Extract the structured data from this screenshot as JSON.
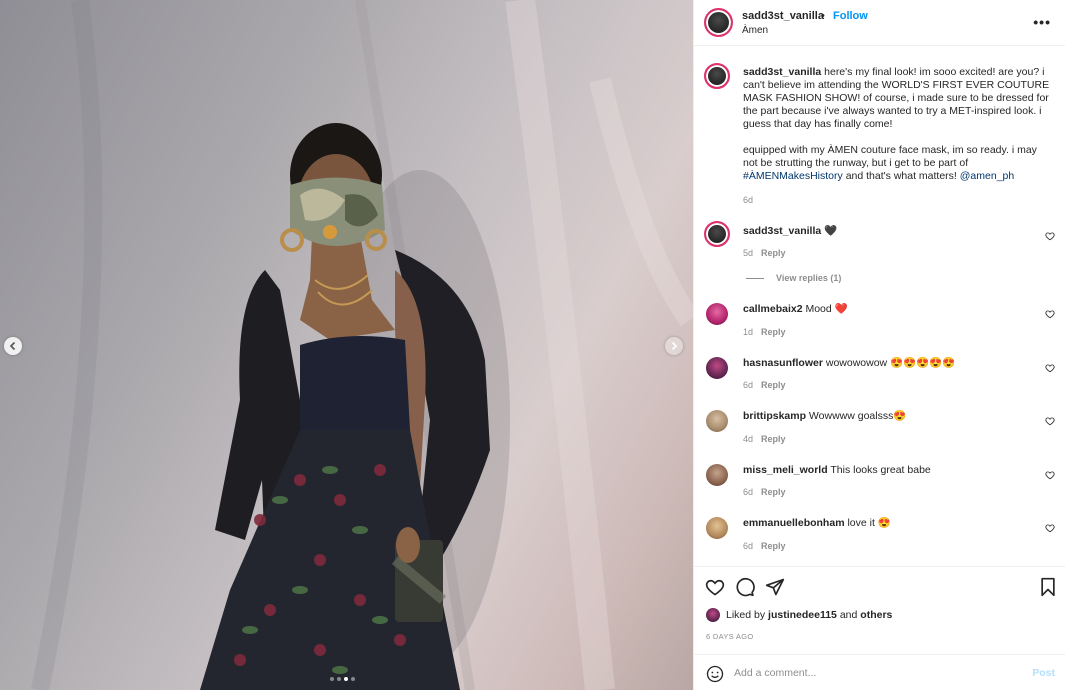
{
  "photo": {
    "carousel_dots": 4,
    "active_dot_index": 2
  },
  "post": {
    "username": "sadd3st_vanilla",
    "separator": "•",
    "follow_label": "Follow",
    "location": "Àmen",
    "more_icon": "more-horizontal-icon"
  },
  "caption": {
    "username": "sadd3st_vanilla",
    "text_1": " here's my final look! im sooo excited! are you? i can't believe im attending the WORLD'S FIRST EVER COUTURE MASK FASHION SHOW! of course, i made sure to be dressed for the part because i've always wanted to try a MET-inspired look. i guess that day has finally come!",
    "text_2": "equipped with my ÀMEN couture face mask, im  so ready. i may not be strutting the runway, but i get to be part of ",
    "hashtag": "#ÀMENMakesHistory",
    "text_3": " and that's what matters! ",
    "mention": "@amen_ph",
    "time": "6d"
  },
  "comments": [
    {
      "username": "sadd3st_vanilla",
      "text": " 🖤",
      "time": "5d",
      "reply_label": "Reply"
    },
    {
      "username": "callmebaix2",
      "text": " Mood ❤️",
      "time": "1d",
      "reply_label": "Reply"
    },
    {
      "username": "hasnasunflower",
      "text": " wowowowow 😍😍😍😍😍",
      "time": "6d",
      "reply_label": "Reply"
    },
    {
      "username": "brittipskamp",
      "text": " Wowwww goalsss😍",
      "time": "4d",
      "reply_label": "Reply"
    },
    {
      "username": "miss_meli_world",
      "text": " This looks great babe",
      "time": "6d",
      "reply_label": "Reply"
    },
    {
      "username": "emmanuellebonham",
      "text": " love it 😍",
      "time": "6d",
      "reply_label": "Reply"
    }
  ],
  "view_replies_label": "View replies (1)",
  "likes": {
    "prefix": "Liked by ",
    "user": "justinedee115",
    "middle": " and ",
    "others": "others"
  },
  "post_date": "6 DAYS AGO",
  "comment_box": {
    "placeholder": "Add a comment...",
    "post_label": "Post"
  },
  "colors": {
    "accent_blue": "#0095f6",
    "post_disabled": "#b2dffc",
    "story_ring": "#e1306c"
  }
}
